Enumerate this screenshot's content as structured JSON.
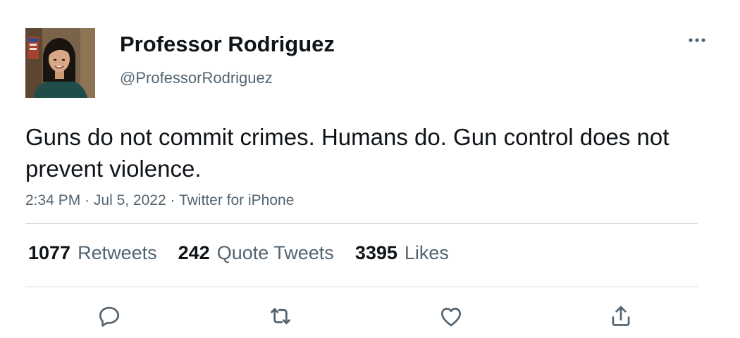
{
  "author": {
    "display_name": "Professor Rodriguez",
    "handle": "@ProfessorRodriguez"
  },
  "tweet": {
    "text": "Guns do not commit crimes. Humans do. Gun control does not prevent violence.",
    "time": "2:34 PM",
    "separator": "·",
    "date": "Jul 5, 2022",
    "source": "Twitter for iPhone"
  },
  "stats": {
    "retweets_count": "1077",
    "retweets_label": "Retweets",
    "quotes_count": "242",
    "quotes_label": "Quote Tweets",
    "likes_count": "3395",
    "likes_label": "Likes"
  },
  "icons": {
    "more": "more-icon",
    "reply": "reply-icon",
    "retweet": "retweet-icon",
    "like": "heart-icon",
    "share": "share-icon"
  },
  "colors": {
    "text_primary": "#0f1419",
    "text_secondary": "#536471",
    "divider": "#cfd9de"
  }
}
